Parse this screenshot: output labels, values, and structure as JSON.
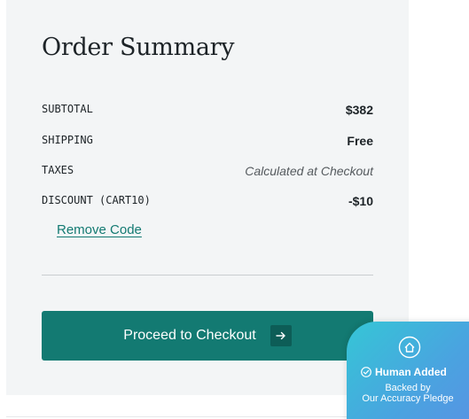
{
  "summary": {
    "title": "Order Summary",
    "rows": [
      {
        "label": "SUBTOTAL",
        "value": "$382"
      },
      {
        "label": "SHIPPING",
        "value": "Free"
      },
      {
        "label": "TAXES",
        "value": "Calculated at Checkout"
      },
      {
        "label": "DISCOUNT (CART10)",
        "value": "-$10"
      }
    ],
    "remove_code_label": "Remove Code",
    "checkout_label": "Proceed to Checkout",
    "checkout_icon": "arrow-right-icon"
  },
  "badge": {
    "icon": "house-icon",
    "check_icon": "check-circle-icon",
    "line1": "Human Added",
    "line2": "Backed by",
    "line3": "Our Accuracy Pledge"
  },
  "colors": {
    "accent": "#137a72",
    "panel_bg": "#f3f5f6",
    "text": "#1d2327",
    "badge_gradient_start": "#35c6d6",
    "badge_gradient_end": "#5b8fe4"
  }
}
